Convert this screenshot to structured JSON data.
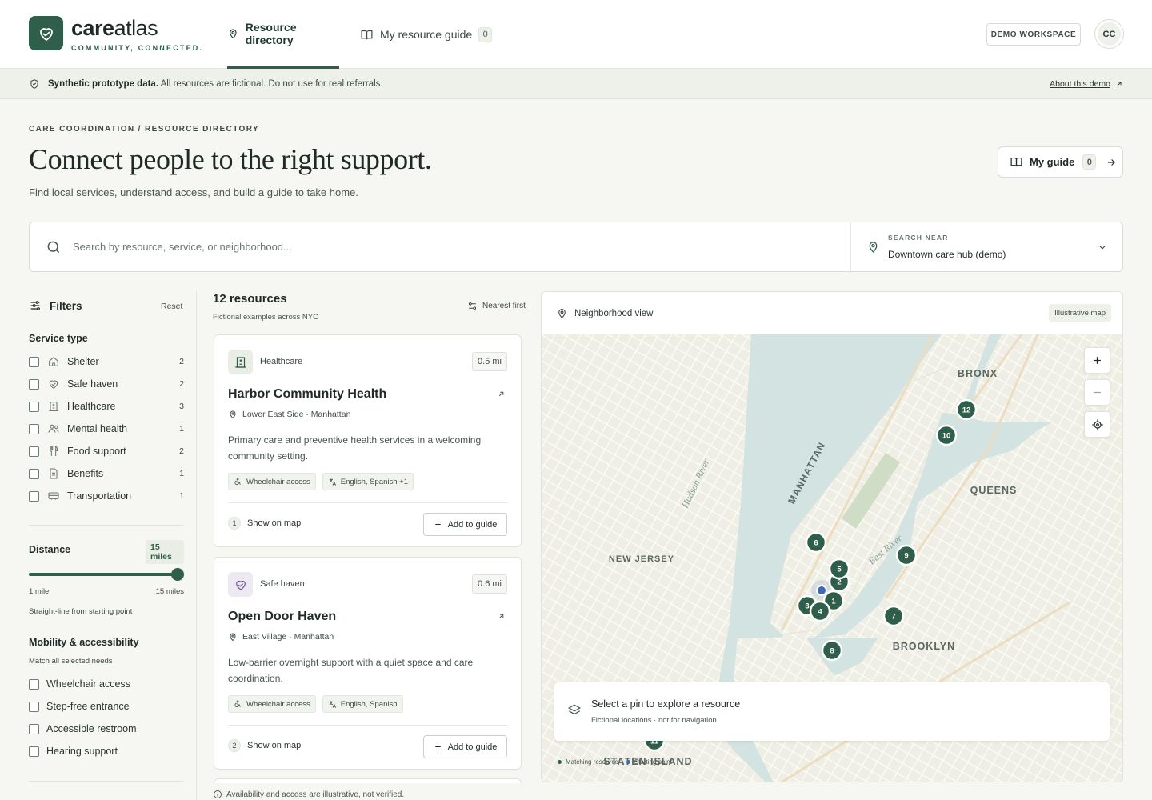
{
  "brand": {
    "name_bold": "care",
    "name_light": "atlas",
    "tagline": "COMMUNITY, CONNECTED."
  },
  "nav": {
    "directory": "Resource directory",
    "guide": "My resource guide",
    "guide_count": "0"
  },
  "header": {
    "workspace": "DEMO WORKSPACE",
    "avatar": "CC"
  },
  "notice": {
    "bold": "Synthetic prototype data.",
    "text": "All resources are fictional. Do not use for real referrals.",
    "link": "About this demo"
  },
  "hero": {
    "breadcrumb": "CARE COORDINATION / RESOURCE DIRECTORY",
    "title": "Connect people to the right support.",
    "subtitle": "Find local services, understand access, and build a guide to take home.",
    "guide_button": "My guide",
    "guide_count": "0"
  },
  "search": {
    "placeholder": "Search by resource, service, or neighborhood...",
    "near_label": "SEARCH NEAR",
    "near_value": "Downtown care hub (demo)"
  },
  "filters": {
    "title": "Filters",
    "reset": "Reset",
    "service_title": "Service type",
    "services": [
      {
        "label": "Shelter",
        "count": "2",
        "icon": "home-icon"
      },
      {
        "label": "Safe haven",
        "count": "2",
        "icon": "heart-hands-icon"
      },
      {
        "label": "Healthcare",
        "count": "3",
        "icon": "hospital-icon"
      },
      {
        "label": "Mental health",
        "count": "1",
        "icon": "people-icon"
      },
      {
        "label": "Food support",
        "count": "2",
        "icon": "utensils-icon"
      },
      {
        "label": "Benefits",
        "count": "1",
        "icon": "document-icon"
      },
      {
        "label": "Transportation",
        "count": "1",
        "icon": "bus-icon"
      }
    ],
    "distance_title": "Distance",
    "distance_value": "15 miles",
    "distance_min": "1 mile",
    "distance_max": "15 miles",
    "distance_fraction": 1.0,
    "distance_note": "Straight-line from starting point",
    "mobility_title": "Mobility & accessibility",
    "mobility_note": "Match all selected needs",
    "mobility": [
      {
        "label": "Wheelchair access"
      },
      {
        "label": "Step-free entrance"
      },
      {
        "label": "Accessible restroom"
      },
      {
        "label": "Hearing support"
      }
    ]
  },
  "results": {
    "count": "12 resources",
    "sub": "Fictional examples across NYC",
    "sort": "Nearest first",
    "show_on_map": "Show on map",
    "add_to_guide": "Add to guide",
    "cards": [
      {
        "category": "Healthcare",
        "distance": "0.5 mi",
        "name": "Harbor Community Health",
        "location": "Lower East Side · Manhattan",
        "description": "Primary care and preventive health services in a welcoming community setting.",
        "tags": [
          "Wheelchair access",
          "English, Spanish +1"
        ],
        "pin": "1"
      },
      {
        "category": "Safe haven",
        "distance": "0.6 mi",
        "name": "Open Door Haven",
        "location": "East Village · Manhattan",
        "description": "Low-barrier overnight support with a quiet space and care coordination.",
        "tags": [
          "Wheelchair access",
          "English, Spanish"
        ],
        "pin": "2"
      }
    ],
    "disclaimer": "Availability and access are illustrative, not verified."
  },
  "map": {
    "title": "Neighborhood view",
    "badge": "Illustrative map",
    "labels": {
      "bronx": "BRONX",
      "manhattan": "MANHATTAN",
      "queens": "QUEENS",
      "new_jersey": "NEW JERSEY",
      "brooklyn": "BROOKLYN",
      "staten_island": "STATEN ISLAND",
      "hudson": "Hudson River",
      "east_river": "East River"
    },
    "pins": [
      "1",
      "2",
      "3",
      "4",
      "5",
      "6",
      "7",
      "8",
      "9",
      "10",
      "11",
      "12"
    ],
    "info_title": "Select a pin to explore a resource",
    "info_sub": "Fictional locations · not for navigation",
    "legend_matching": "Matching resource",
    "legend_start": "Starting point",
    "colors": {
      "accent": "#2f5e4a",
      "water": "#d3e3e1",
      "land": "#efeee4",
      "start": "#3b6bb5"
    }
  }
}
